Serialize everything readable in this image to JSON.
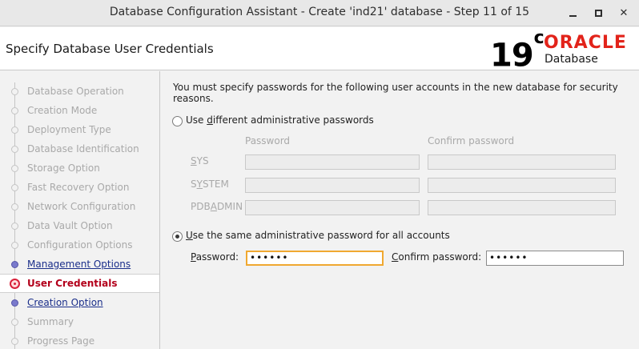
{
  "window": {
    "title": "Database Configuration Assistant - Create 'ind21' database - Step 11 of 15"
  },
  "header": {
    "title": "Specify Database User Credentials",
    "logo": {
      "version": "19",
      "version_suffix": "c",
      "brand": "ORACLE",
      "product": "Database"
    }
  },
  "steps": [
    {
      "label": "Database Operation",
      "state": "disabled"
    },
    {
      "label": "Creation Mode",
      "state": "disabled"
    },
    {
      "label": "Deployment Type",
      "state": "disabled"
    },
    {
      "label": "Database Identification",
      "state": "disabled"
    },
    {
      "label": "Storage Option",
      "state": "disabled"
    },
    {
      "label": "Fast Recovery Option",
      "state": "disabled"
    },
    {
      "label": "Network Configuration",
      "state": "disabled"
    },
    {
      "label": "Data Vault Option",
      "state": "disabled"
    },
    {
      "label": "Configuration Options",
      "state": "disabled"
    },
    {
      "label": "Management Options",
      "state": "link"
    },
    {
      "label": "User Credentials",
      "state": "active"
    },
    {
      "label": "Creation Option",
      "state": "link"
    },
    {
      "label": "Summary",
      "state": "disabled"
    },
    {
      "label": "Progress Page",
      "state": "disabled"
    }
  ],
  "main": {
    "intro": "You must specify passwords for the following user accounts in the new database for security reasons.",
    "option_different": {
      "pre": "Use ",
      "key": "d",
      "post": "ifferent administrative passwords",
      "selected": false
    },
    "columns": {
      "password": "Password",
      "confirm": "Confirm password"
    },
    "rows": [
      {
        "pre": "",
        "key": "S",
        "post": "YS"
      },
      {
        "pre": "S",
        "key": "Y",
        "post": "STEM"
      },
      {
        "pre": "PDB",
        "key": "A",
        "post": "DMIN"
      }
    ],
    "option_same": {
      "pre": "",
      "key": "U",
      "post": "se the same administrative password for all accounts",
      "selected": true
    },
    "password_label": {
      "pre": "",
      "key": "P",
      "post": "assword:"
    },
    "password_value": "••••••",
    "confirm_label": {
      "pre": "",
      "key": "C",
      "post": "onfirm password:"
    },
    "confirm_value": "••••••"
  }
}
